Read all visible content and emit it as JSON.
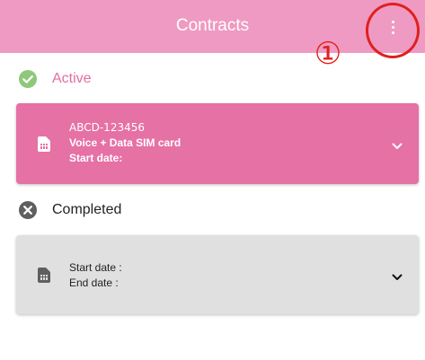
{
  "appbar": {
    "title": "Contracts"
  },
  "annotation": {
    "number": "①"
  },
  "sections": {
    "active": {
      "label": "Active"
    },
    "completed": {
      "label": "Completed"
    }
  },
  "active_contract": {
    "number": "ABCD-123456",
    "plan": "Voice + Data SIM card",
    "start": "Start date:"
  },
  "completed_contract": {
    "start": "Start date :",
    "end": "End date :"
  },
  "colors": {
    "appbar": "#ef9ac2",
    "active_card": "#e671a5",
    "active_text": "#e06fa2",
    "check_green": "#8ec97a",
    "completed_card": "#e0e0e0",
    "annotation_red": "#e0201d"
  },
  "icons": {
    "menu": "more-vert-icon",
    "active": "check-circle-icon",
    "completed": "cancel-circle-icon",
    "sim": "sim-card-icon",
    "expand": "chevron-down-icon"
  }
}
